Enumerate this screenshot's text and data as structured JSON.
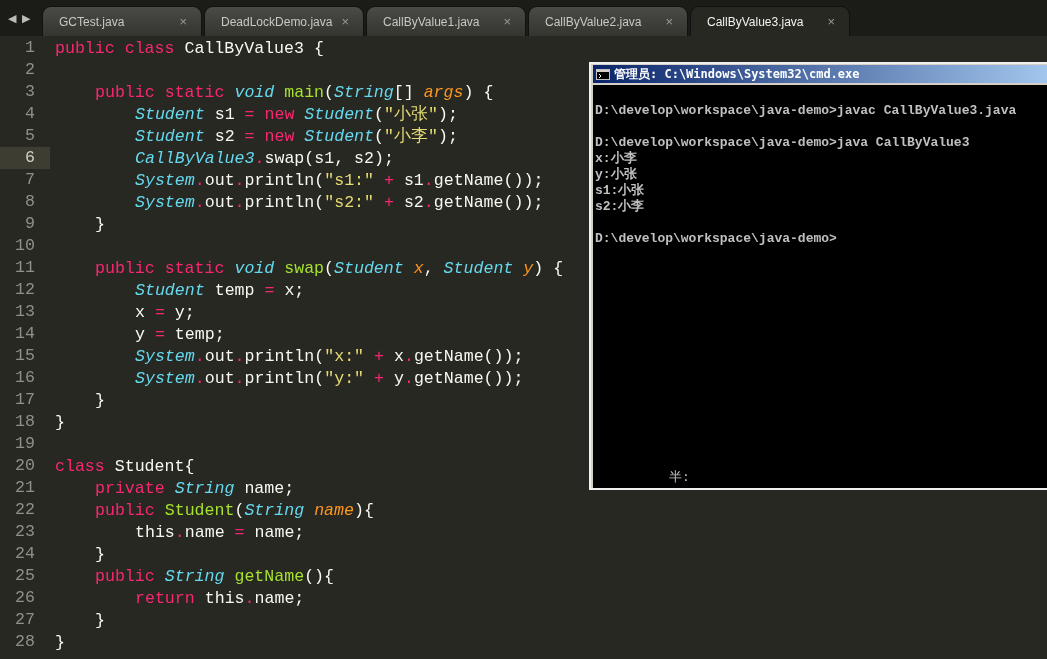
{
  "nav": {
    "back": "◀",
    "forward": "▶"
  },
  "tabs": [
    {
      "label": "GCTest.java",
      "close": "×",
      "selected": false
    },
    {
      "label": "DeadLockDemo.java",
      "close": "×",
      "selected": false
    },
    {
      "label": "CallByValue1.java",
      "close": "×",
      "selected": false
    },
    {
      "label": "CallByValue2.java",
      "close": "×",
      "selected": false
    },
    {
      "label": "CallByValue3.java",
      "close": "×",
      "selected": true
    }
  ],
  "editor": {
    "lines": [
      {
        "number": "1",
        "current": false,
        "tokens": [
          {
            "kind": "kw",
            "text": "public class "
          },
          {
            "kind": "plain",
            "text": "CallByValue3 {"
          }
        ],
        "children": [
          {
            "number": "2",
            "current": false
          },
          {
            "number": "3",
            "current": false,
            "tokens": [
              {
                "kind": "kw",
                "text": "public static "
              },
              {
                "kind": "type",
                "text": "void "
              },
              {
                "kind": "fn",
                "text": "main"
              },
              {
                "kind": "plain",
                "text": "("
              },
              {
                "kind": "type",
                "text": "String"
              },
              {
                "kind": "plain",
                "text": "[] "
              },
              {
                "kind": "param",
                "text": "args"
              },
              {
                "kind": "plain",
                "text": ") {"
              }
            ],
            "children": [
              {
                "number": "4",
                "current": false,
                "tokens": [
                  {
                    "kind": "type",
                    "text": "Student"
                  },
                  {
                    "kind": "plain",
                    "text": " s1 "
                  },
                  {
                    "kind": "kw",
                    "text": "= new "
                  },
                  {
                    "kind": "type",
                    "text": "Student"
                  },
                  {
                    "kind": "plain",
                    "text": "("
                  },
                  {
                    "kind": "str",
                    "text": "\"小张\""
                  },
                  {
                    "kind": "plain",
                    "text": ");"
                  }
                ]
              },
              {
                "number": "5",
                "current": false,
                "tokens": [
                  {
                    "kind": "type",
                    "text": "Student"
                  },
                  {
                    "kind": "plain",
                    "text": " s2 "
                  },
                  {
                    "kind": "kw",
                    "text": "= new "
                  },
                  {
                    "kind": "type",
                    "text": "Student"
                  },
                  {
                    "kind": "plain",
                    "text": "("
                  },
                  {
                    "kind": "str",
                    "text": "\"小李\""
                  },
                  {
                    "kind": "plain",
                    "text": ");"
                  }
                ]
              },
              {
                "number": "6",
                "current": true,
                "tokens": [
                  {
                    "kind": "type",
                    "text": "CallByValue3"
                  },
                  {
                    "kind": "kw",
                    "text": "."
                  },
                  {
                    "kind": "plain",
                    "text": "swap(s1, s2);"
                  }
                ]
              },
              {
                "number": "7",
                "current": false,
                "tokens": [
                  {
                    "kind": "type",
                    "text": "System"
                  },
                  {
                    "kind": "kw",
                    "text": "."
                  },
                  {
                    "kind": "plain",
                    "text": "out"
                  },
                  {
                    "kind": "kw",
                    "text": "."
                  },
                  {
                    "kind": "plain",
                    "text": "println("
                  },
                  {
                    "kind": "str",
                    "text": "\"s1:\""
                  },
                  {
                    "kind": "kw",
                    "text": " + "
                  },
                  {
                    "kind": "plain",
                    "text": "s1"
                  },
                  {
                    "kind": "kw",
                    "text": "."
                  },
                  {
                    "kind": "plain",
                    "text": "getName());"
                  }
                ]
              },
              {
                "number": "8",
                "current": false,
                "tokens": [
                  {
                    "kind": "type",
                    "text": "System"
                  },
                  {
                    "kind": "kw",
                    "text": "."
                  },
                  {
                    "kind": "plain",
                    "text": "out"
                  },
                  {
                    "kind": "kw",
                    "text": "."
                  },
                  {
                    "kind": "plain",
                    "text": "println("
                  },
                  {
                    "kind": "str",
                    "text": "\"s2:\""
                  },
                  {
                    "kind": "kw",
                    "text": " + "
                  },
                  {
                    "kind": "plain",
                    "text": "s2"
                  },
                  {
                    "kind": "kw",
                    "text": "."
                  },
                  {
                    "kind": "plain",
                    "text": "getName());"
                  }
                ]
              }
            ]
          },
          {
            "number": "9",
            "current": false,
            "tokens": [
              {
                "kind": "plain",
                "text": "}"
              }
            ]
          },
          {
            "number": "10",
            "current": false
          },
          {
            "number": "11",
            "current": false,
            "tokens": [
              {
                "kind": "kw",
                "text": "public static "
              },
              {
                "kind": "type",
                "text": "void "
              },
              {
                "kind": "fn",
                "text": "swap"
              },
              {
                "kind": "plain",
                "text": "("
              },
              {
                "kind": "type",
                "text": "Student "
              },
              {
                "kind": "param",
                "text": "x"
              },
              {
                "kind": "plain",
                "text": ", "
              },
              {
                "kind": "type",
                "text": "Student "
              },
              {
                "kind": "param",
                "text": "y"
              },
              {
                "kind": "plain",
                "text": ") {"
              }
            ],
            "children": [
              {
                "number": "12",
                "current": false,
                "tokens": [
                  {
                    "kind": "type",
                    "text": "Student"
                  },
                  {
                    "kind": "plain",
                    "text": " temp "
                  },
                  {
                    "kind": "kw",
                    "text": "="
                  },
                  {
                    "kind": "plain",
                    "text": " x;"
                  }
                ]
              },
              {
                "number": "13",
                "current": false,
                "tokens": [
                  {
                    "kind": "plain",
                    "text": "x "
                  },
                  {
                    "kind": "kw",
                    "text": "="
                  },
                  {
                    "kind": "plain",
                    "text": " y;"
                  }
                ]
              },
              {
                "number": "14",
                "current": false,
                "tokens": [
                  {
                    "kind": "plain",
                    "text": "y "
                  },
                  {
                    "kind": "kw",
                    "text": "="
                  },
                  {
                    "kind": "plain",
                    "text": " temp;"
                  }
                ]
              },
              {
                "number": "15",
                "current": false,
                "tokens": [
                  {
                    "kind": "type",
                    "text": "System"
                  },
                  {
                    "kind": "kw",
                    "text": "."
                  },
                  {
                    "kind": "plain",
                    "text": "out"
                  },
                  {
                    "kind": "kw",
                    "text": "."
                  },
                  {
                    "kind": "plain",
                    "text": "println("
                  },
                  {
                    "kind": "str",
                    "text": "\"x:\""
                  },
                  {
                    "kind": "kw",
                    "text": " + "
                  },
                  {
                    "kind": "plain",
                    "text": "x"
                  },
                  {
                    "kind": "kw",
                    "text": "."
                  },
                  {
                    "kind": "plain",
                    "text": "getName());"
                  }
                ]
              },
              {
                "number": "16",
                "current": false,
                "tokens": [
                  {
                    "kind": "type",
                    "text": "System"
                  },
                  {
                    "kind": "kw",
                    "text": "."
                  },
                  {
                    "kind": "plain",
                    "text": "out"
                  },
                  {
                    "kind": "kw",
                    "text": "."
                  },
                  {
                    "kind": "plain",
                    "text": "println("
                  },
                  {
                    "kind": "str",
                    "text": "\"y:\""
                  },
                  {
                    "kind": "kw",
                    "text": " + "
                  },
                  {
                    "kind": "plain",
                    "text": "y"
                  },
                  {
                    "kind": "kw",
                    "text": "."
                  },
                  {
                    "kind": "plain",
                    "text": "getName());"
                  }
                ]
              }
            ]
          },
          {
            "number": "17",
            "current": false,
            "tokens": [
              {
                "kind": "plain",
                "text": "}"
              }
            ]
          }
        ]
      },
      {
        "number": "18",
        "current": false,
        "tokens": [
          {
            "kind": "plain",
            "text": "}"
          }
        ]
      },
      {
        "number": "19",
        "current": false
      },
      {
        "number": "20",
        "current": false,
        "tokens": [
          {
            "kind": "kw",
            "text": "class "
          },
          {
            "kind": "plain",
            "text": "Student{"
          }
        ],
        "children": [
          {
            "number": "21",
            "current": false,
            "tokens": [
              {
                "kind": "kw",
                "text": "private "
              },
              {
                "kind": "type",
                "text": "String"
              },
              {
                "kind": "plain",
                "text": " name;"
              }
            ]
          },
          {
            "number": "22",
            "current": false,
            "tokens": [
              {
                "kind": "kw",
                "text": "public "
              },
              {
                "kind": "fn",
                "text": "Student"
              },
              {
                "kind": "plain",
                "text": "("
              },
              {
                "kind": "type",
                "text": "String "
              },
              {
                "kind": "param",
                "text": "name"
              },
              {
                "kind": "plain",
                "text": "){"
              }
            ],
            "children": [
              {
                "number": "23",
                "current": false,
                "tokens": [
                  {
                    "kind": "plain",
                    "text": "this"
                  },
                  {
                    "kind": "kw",
                    "text": "."
                  },
                  {
                    "kind": "plain",
                    "text": "name "
                  },
                  {
                    "kind": "kw",
                    "text": "="
                  },
                  {
                    "kind": "plain",
                    "text": " name;"
                  }
                ]
              }
            ]
          },
          {
            "number": "24",
            "current": false,
            "tokens": [
              {
                "kind": "plain",
                "text": "}"
              }
            ]
          },
          {
            "number": "25",
            "current": false,
            "tokens": [
              {
                "kind": "kw",
                "text": "public "
              },
              {
                "kind": "type",
                "text": "String "
              },
              {
                "kind": "fn",
                "text": "getName"
              },
              {
                "kind": "plain",
                "text": "(){"
              }
            ],
            "children": [
              {
                "number": "26",
                "current": false,
                "tokens": [
                  {
                    "kind": "kw",
                    "text": "return "
                  },
                  {
                    "kind": "plain",
                    "text": "this"
                  },
                  {
                    "kind": "kw",
                    "text": "."
                  },
                  {
                    "kind": "plain",
                    "text": "name;"
                  }
                ]
              }
            ]
          },
          {
            "number": "27",
            "current": false,
            "tokens": [
              {
                "kind": "plain",
                "text": "}"
              }
            ]
          }
        ]
      },
      {
        "number": "28",
        "current": false,
        "tokens": [
          {
            "kind": "plain",
            "text": "}"
          }
        ]
      }
    ]
  },
  "console": {
    "title": "管理员: C:\\Windows\\System32\\cmd.exe",
    "blocks": [
      {
        "lines": [
          "D:\\develop\\workspace\\java-demo>javac CallByValue3.java"
        ]
      },
      {
        "lines": [
          "D:\\develop\\workspace\\java-demo>java CallByValue3",
          "x:小李",
          "y:小张",
          "s1:小张",
          "s2:小李"
        ]
      },
      {
        "lines": [
          "D:\\develop\\workspace\\java-demo>"
        ]
      }
    ],
    "ime_status": "半:"
  }
}
